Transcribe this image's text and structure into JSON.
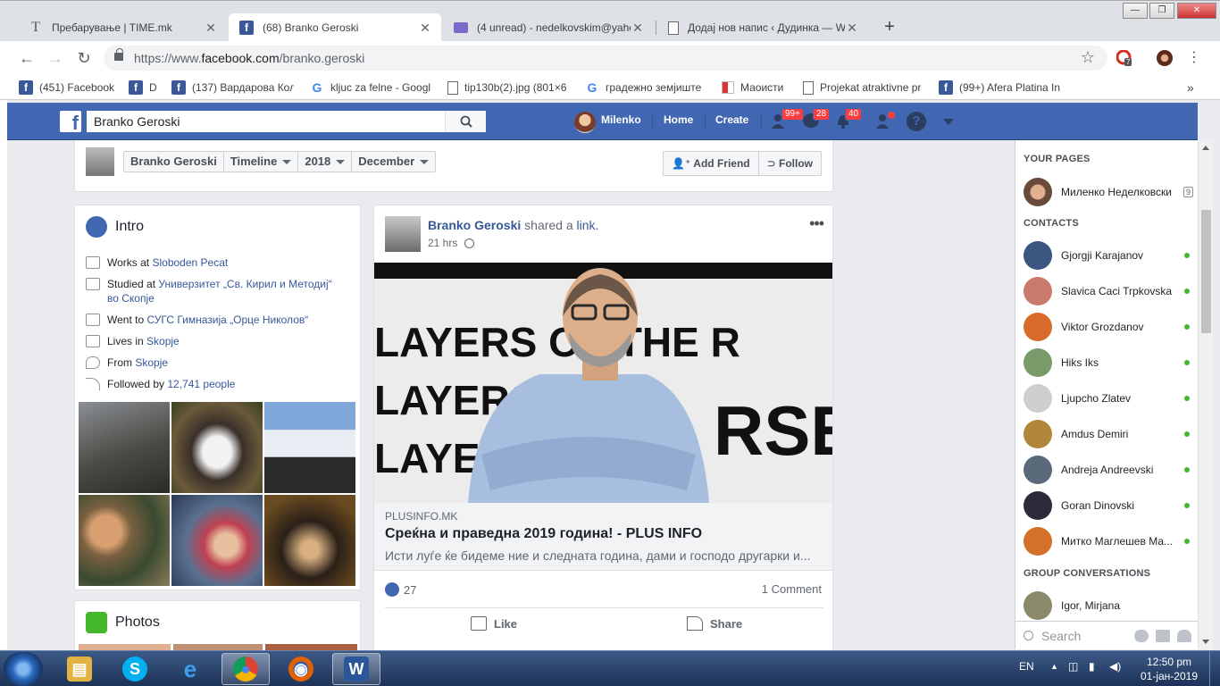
{
  "browser": {
    "tabs": [
      {
        "title": "Пребарување | TIME.mk",
        "icon": "time-mk-favicon"
      },
      {
        "title": "(68) Branko Geroski",
        "icon": "facebook-favicon",
        "active": true
      },
      {
        "title": "(4 unread) - nedelkovskim@yahoo",
        "icon": "mail-favicon"
      },
      {
        "title": "Додај нов напис ‹ Дудинка — W",
        "icon": "document-favicon"
      }
    ],
    "new_tab": "+",
    "window_controls": {
      "minimize": "—",
      "restore": "❐",
      "close": "✕"
    },
    "url_scheme": "https://www.",
    "url_host": "facebook.com",
    "url_path": "/branko.geroski",
    "extension_badge": "7",
    "bookmarks": [
      {
        "label": "(451) Facebook",
        "icon": "facebook-favicon"
      },
      {
        "label": "D",
        "icon": "facebook-favicon"
      },
      {
        "label": "(137) Вардарова Кол",
        "icon": "facebook-favicon"
      },
      {
        "label": "kljuc za felne - Googl",
        "icon": "google-favicon"
      },
      {
        "label": "tip130b(2).jpg (801×6",
        "icon": "document-favicon"
      },
      {
        "label": "градежно земјиште",
        "icon": "google-favicon"
      },
      {
        "label": "Маоисти",
        "icon": "grid-favicon"
      },
      {
        "label": "Projekat atraktivne pr",
        "icon": "document-favicon"
      },
      {
        "label": "(99+) Afera Platina In",
        "icon": "facebook-favicon"
      }
    ],
    "bookmarks_more": "»"
  },
  "fb": {
    "search_value": "Branko Geroski",
    "user_name": "Milenko",
    "nav": {
      "home": "Home",
      "create": "Create"
    },
    "badges": {
      "friends": "99+",
      "messages": "28",
      "notifications": "40"
    },
    "help": "?"
  },
  "profile_header": {
    "crumbs": [
      "Branko Geroski",
      "Timeline",
      "2018",
      "December"
    ],
    "add_friend": "Add Friend",
    "follow": "Follow"
  },
  "intro": {
    "title": "Intro",
    "rows": [
      {
        "prefix": "Works at ",
        "link": "Sloboden Pecat",
        "icon": "briefcase-icon"
      },
      {
        "prefix": "Studied at ",
        "link": "Универзитет „Св. Кирил и Методиј“ во Скопје",
        "icon": "graduation-cap-icon"
      },
      {
        "prefix": "Went to ",
        "link": "СУГС Гимназија „Орце Николов“",
        "icon": "graduation-cap-icon"
      },
      {
        "prefix": "Lives in ",
        "link": "Skopje",
        "icon": "home-icon"
      },
      {
        "prefix": "From ",
        "link": "Skopje",
        "icon": "location-pin-icon"
      },
      {
        "prefix": "Followed by ",
        "link": "12,741 people",
        "icon": "rss-icon"
      }
    ]
  },
  "photos_card": {
    "title": "Photos"
  },
  "post": {
    "author": "Branko Geroski",
    "action_text": " shared a ",
    "action_link": "link.",
    "time": "21 hrs",
    "image_text": [
      "LAYERS OF THE R",
      "LAYERS",
      "LAYERS",
      "RSE"
    ],
    "link_domain": "PLUSINFO.MK",
    "link_title": "Среќна и праведна 2019 година! - PLUS INFO",
    "link_desc": "Исти луѓе ќе бидеме ние и следната година, дами и господо другарки и...",
    "likes": "27",
    "comments": "1 Comment",
    "like_label": "Like",
    "share_label": "Share",
    "more": "•••"
  },
  "chat": {
    "your_pages_label": "YOUR PAGES",
    "pages": [
      {
        "name": "Миленко Неделковски",
        "extra": "9"
      }
    ],
    "contacts_label": "CONTACTS",
    "contacts": [
      {
        "name": "Gjorgji Karajanov",
        "color": "#3b5680"
      },
      {
        "name": "Slavica Caci Trpkovska",
        "color": "#c97a6a"
      },
      {
        "name": "Viktor Grozdanov",
        "color": "#d86a2a"
      },
      {
        "name": "Hiks Iks",
        "color": "#7a9a6a"
      },
      {
        "name": "Ljupcho Zlatev",
        "color": "#cfcfcf"
      },
      {
        "name": "Amdus Demiri",
        "color": "#b0873a"
      },
      {
        "name": "Andreja Andreevski",
        "color": "#5a6a7a"
      },
      {
        "name": "Goran Dinovski",
        "color": "#2a2a3a"
      },
      {
        "name": "Митко Маглешев Ма...",
        "color": "#d4702a"
      }
    ],
    "group_label": "GROUP CONVERSATIONS",
    "groups": [
      {
        "name": "Igor, Mirjana",
        "color": "#8a8a6a"
      }
    ],
    "search_placeholder": "Search"
  },
  "taskbar": {
    "apps": [
      {
        "name": "windows-explorer",
        "glyph": "▤",
        "color": "#e3b341"
      },
      {
        "name": "skype",
        "glyph": "S",
        "color": "#00aff0"
      },
      {
        "name": "internet-explorer",
        "glyph": "e",
        "color": "#1e78d6"
      },
      {
        "name": "chrome",
        "glyph": "●",
        "color": "#db4437",
        "active": true
      },
      {
        "name": "firefox",
        "glyph": "◉",
        "color": "#e66000"
      },
      {
        "name": "word",
        "glyph": "W",
        "color": "#2b579a"
      }
    ],
    "lang": "EN",
    "time": "12:50 pm",
    "date": "01-јан-2019"
  }
}
